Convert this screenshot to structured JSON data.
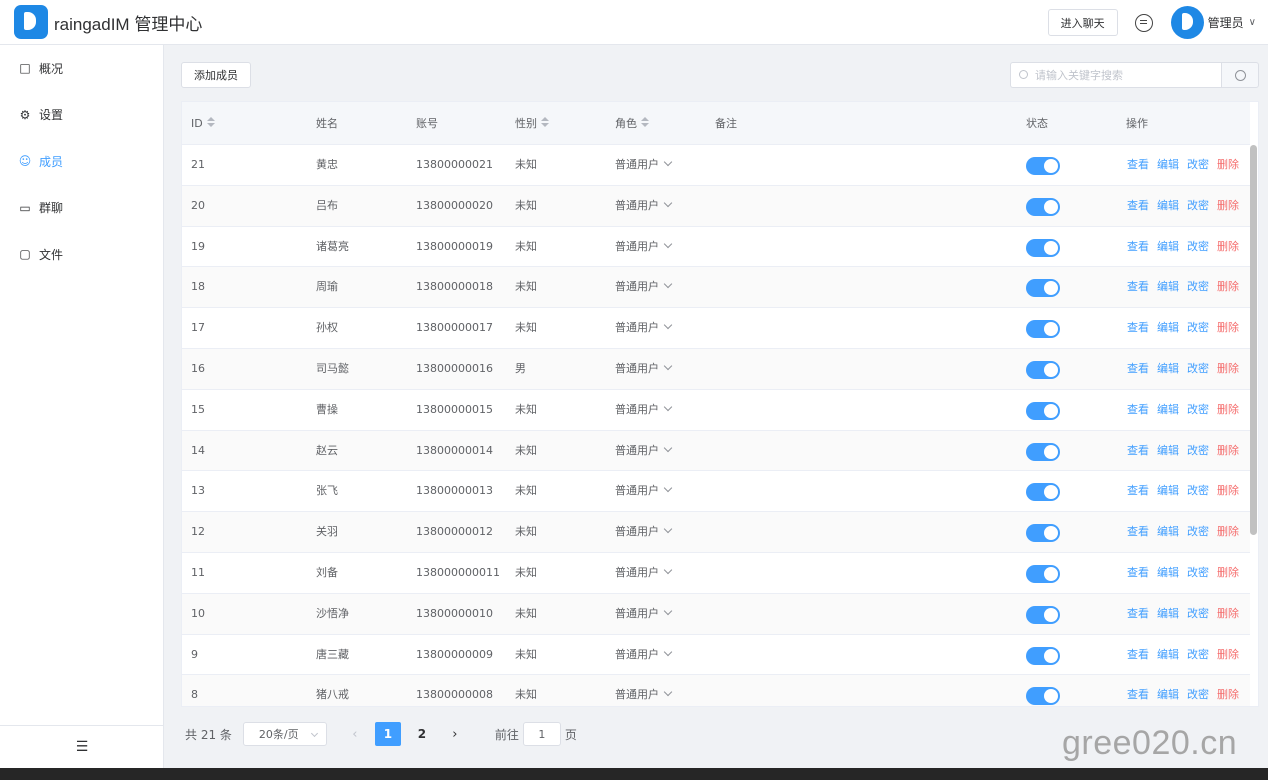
{
  "app": {
    "title": "raingadIM 管理中心"
  },
  "header": {
    "enter_chat": "进入聊天",
    "user_name": "管理员"
  },
  "sidebar": {
    "items": [
      {
        "label": "概况",
        "icon": "presentation-icon",
        "active": false
      },
      {
        "label": "设置",
        "icon": "gear-icon",
        "active": false
      },
      {
        "label": "成员",
        "icon": "user-icon",
        "active": true
      },
      {
        "label": "群聊",
        "icon": "chat-bubble-icon",
        "active": false
      },
      {
        "label": "文件",
        "icon": "folder-icon",
        "active": false
      }
    ],
    "collapse_icon": "collapse-menu-icon"
  },
  "toolbar": {
    "add_label": "添加成员",
    "search_placeholder": "请输入关键字搜索"
  },
  "table": {
    "columns": [
      "ID",
      "姓名",
      "账号",
      "性别",
      "角色",
      "备注",
      "状态",
      "操作"
    ],
    "actions": {
      "view": "查看",
      "edit": "编辑",
      "password": "改密",
      "delete": "删除"
    },
    "rows": [
      {
        "id": "21",
        "name": "黄忠",
        "account": "13800000021",
        "gender": "未知",
        "role": "普通用户",
        "note": "",
        "status": true
      },
      {
        "id": "20",
        "name": "吕布",
        "account": "13800000020",
        "gender": "未知",
        "role": "普通用户",
        "note": "",
        "status": true
      },
      {
        "id": "19",
        "name": "诸葛亮",
        "account": "13800000019",
        "gender": "未知",
        "role": "普通用户",
        "note": "",
        "status": true
      },
      {
        "id": "18",
        "name": "周瑜",
        "account": "13800000018",
        "gender": "未知",
        "role": "普通用户",
        "note": "",
        "status": true
      },
      {
        "id": "17",
        "name": "孙权",
        "account": "13800000017",
        "gender": "未知",
        "role": "普通用户",
        "note": "",
        "status": true
      },
      {
        "id": "16",
        "name": "司马懿",
        "account": "13800000016",
        "gender": "男",
        "role": "普通用户",
        "note": "",
        "status": true
      },
      {
        "id": "15",
        "name": "曹操",
        "account": "13800000015",
        "gender": "未知",
        "role": "普通用户",
        "note": "",
        "status": true
      },
      {
        "id": "14",
        "name": "赵云",
        "account": "13800000014",
        "gender": "未知",
        "role": "普通用户",
        "note": "",
        "status": true
      },
      {
        "id": "13",
        "name": "张飞",
        "account": "13800000013",
        "gender": "未知",
        "role": "普通用户",
        "note": "",
        "status": true
      },
      {
        "id": "12",
        "name": "关羽",
        "account": "13800000012",
        "gender": "未知",
        "role": "普通用户",
        "note": "",
        "status": true
      },
      {
        "id": "11",
        "name": "刘备",
        "account": "138000000011",
        "gender": "未知",
        "role": "普通用户",
        "note": "",
        "status": true
      },
      {
        "id": "10",
        "name": "沙悟净",
        "account": "13800000010",
        "gender": "未知",
        "role": "普通用户",
        "note": "",
        "status": true
      },
      {
        "id": "9",
        "name": "唐三藏",
        "account": "13800000009",
        "gender": "未知",
        "role": "普通用户",
        "note": "",
        "status": true
      },
      {
        "id": "8",
        "name": "猪八戒",
        "account": "13800000008",
        "gender": "未知",
        "role": "普通用户",
        "note": "",
        "status": true
      }
    ]
  },
  "pagination": {
    "total": "共 21 条",
    "page_size": "20条/页",
    "pages": [
      "1",
      "2"
    ],
    "current": "1",
    "goto_prefix": "前往",
    "goto_value": "1",
    "goto_suffix": "页"
  },
  "watermark": "gree020.cn",
  "colors": {
    "primary": "#409eff",
    "danger": "#f56c6c",
    "brand": "#1e88e5"
  }
}
